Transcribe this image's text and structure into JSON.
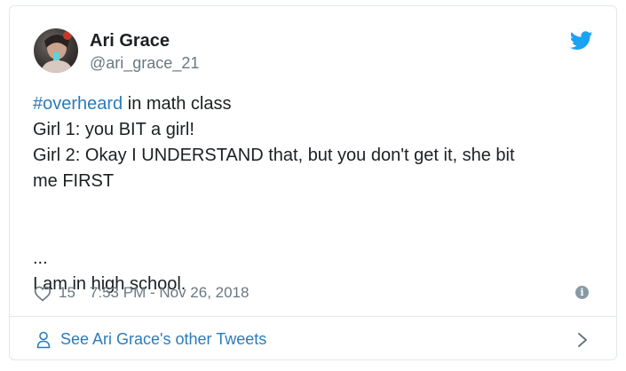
{
  "tweet": {
    "author_name": "Ari Grace",
    "author_handle": "@ari_grace_21",
    "hashtag": "#overheard",
    "text_line1_rest": " in math class",
    "text_line2": "Girl 1: you BIT a girl!",
    "text_line3": "Girl 2: Okay I UNDERSTAND that, but you don't get it, she bit",
    "text_line4": "me FIRST",
    "text_line5": "...",
    "text_line6": "I am in high school.",
    "likes_count": "15",
    "timestamp": "7:53 PM - Nov 26, 2018"
  },
  "footer": {
    "see_more_label": "See Ari Grace's other Tweets"
  },
  "icons": {
    "brand": "twitter-bird-icon",
    "like": "heart-icon",
    "info": "info-icon",
    "profile": "person-icon",
    "next": "chevron-right-icon"
  },
  "colors": {
    "brand": "#1da1f2",
    "link": "#2b7bb9",
    "muted": "#697882",
    "text": "#1c2022",
    "border": "#e1e8ed"
  }
}
